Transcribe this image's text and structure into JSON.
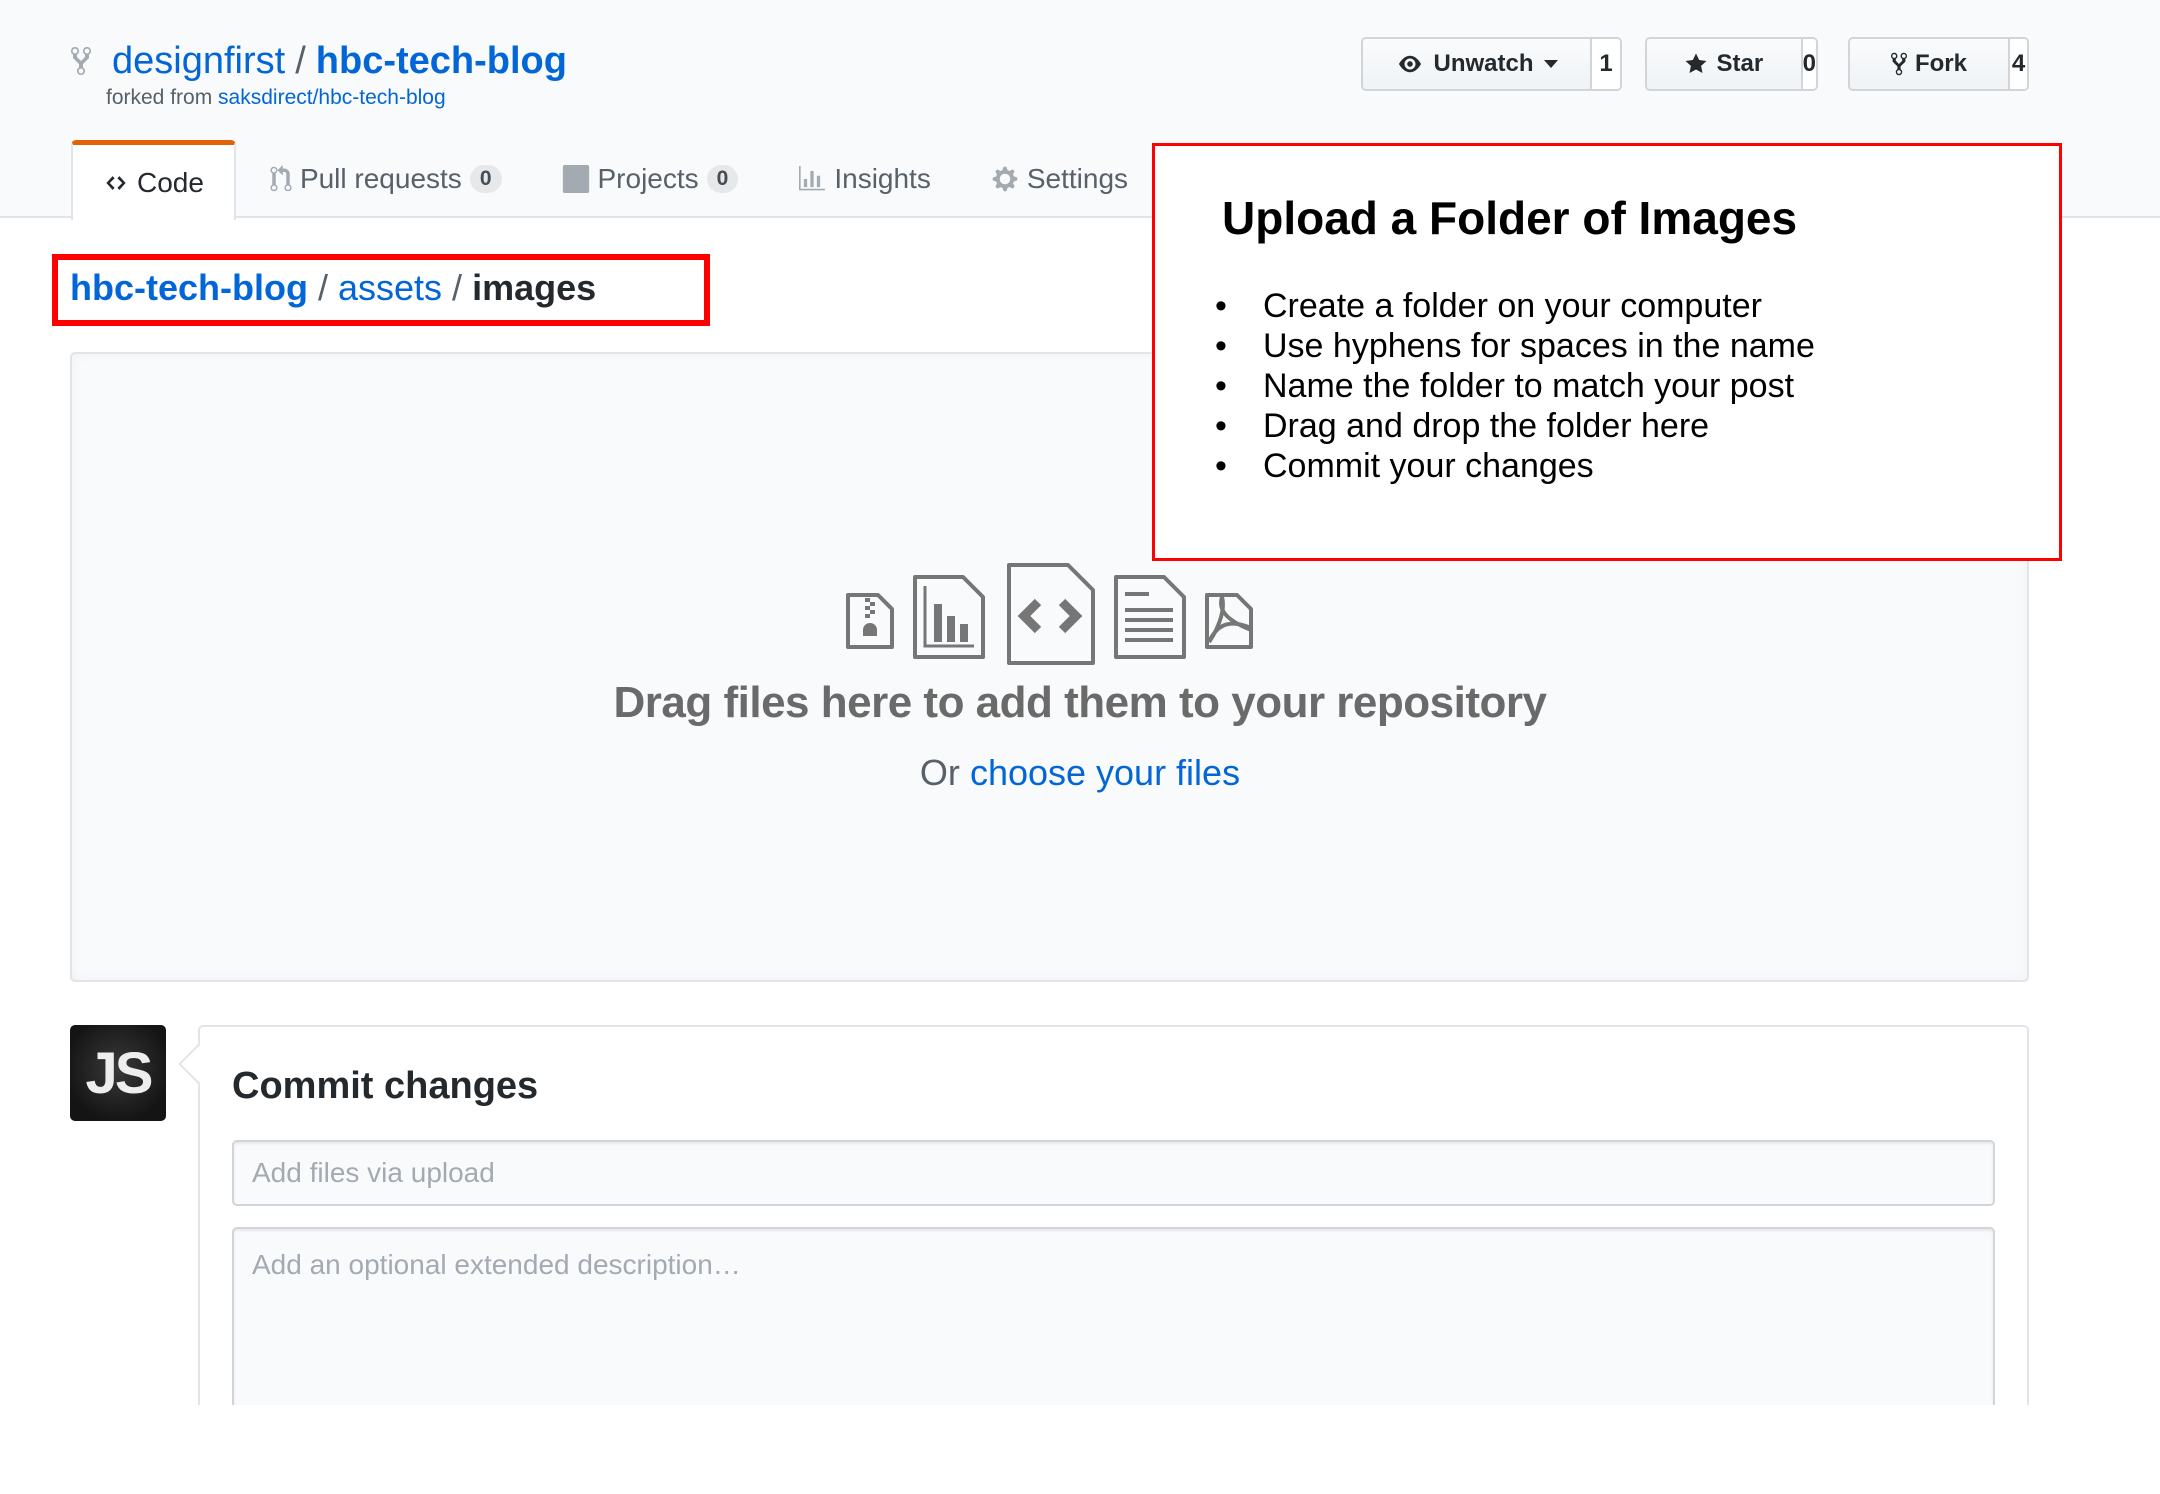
{
  "repo": {
    "owner": "designfirst",
    "separator": "/",
    "name": "hbc-tech-blog",
    "forked_from_prefix": "forked from",
    "forked_from_link": "saksdirect/hbc-tech-blog"
  },
  "actions": {
    "watch": {
      "label": "Unwatch",
      "count": "1",
      "icon": "eye-icon"
    },
    "star": {
      "label": "Star",
      "count": "0",
      "icon": "star-icon"
    },
    "fork": {
      "label": "Fork",
      "count": "4",
      "icon": "repo-forked-icon"
    }
  },
  "tabs": [
    {
      "label": "Code",
      "icon": "code-icon",
      "selected": true
    },
    {
      "label": "Pull requests",
      "icon": "git-pull-request-icon",
      "counter": "0"
    },
    {
      "label": "Projects",
      "icon": "project-icon",
      "counter": "0"
    },
    {
      "label": "Insights",
      "icon": "graph-icon"
    },
    {
      "label": "Settings",
      "icon": "gear-icon"
    }
  ],
  "breadcrumb": {
    "root": "hbc-tech-blog",
    "separator": "/",
    "middle": "assets",
    "final": "images"
  },
  "dropzone": {
    "title": "Drag files here to add them to your repository",
    "sub_prefix": "Or",
    "sub_link": "choose your files",
    "icons": [
      "file-zip-icon",
      "file-chart-icon",
      "file-code-icon",
      "file-text-icon",
      "file-pdf-icon"
    ]
  },
  "annotation": {
    "title": "Upload a Folder of Images",
    "bullet": "•",
    "items": [
      "Create a folder on your computer",
      "Use hyphens for spaces in the name",
      "Name the folder to match your post",
      "Drag and drop the folder here",
      "Commit your changes"
    ],
    "border_color": "#ff0000"
  },
  "commit": {
    "avatar_initials": "JS",
    "heading": "Commit changes",
    "summary_placeholder": "Add files via upload",
    "summary_value": "",
    "description_placeholder": "Add an optional extended description…",
    "description_value": ""
  },
  "colors": {
    "link": "#0366d6",
    "tab_accent": "#e36209",
    "highlight": "#ff0000"
  }
}
